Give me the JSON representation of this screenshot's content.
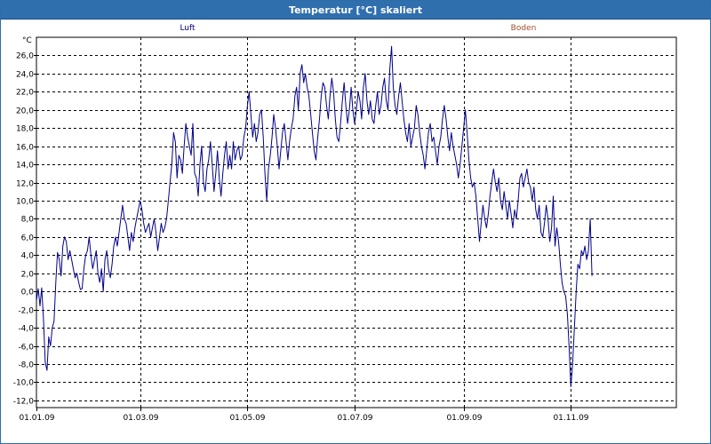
{
  "window": {
    "title": "Temperatur [°C] skaliert"
  },
  "chart_data": {
    "type": "line",
    "title": "Temperatur [°C] skaliert",
    "ylabel": "°C",
    "xlabel": "",
    "ylim": [
      -12.8,
      28.0
    ],
    "grid": true,
    "legend_placement": "top",
    "x_tick_labels": [
      "01.01.09",
      "01.03.09",
      "01.05.09",
      "01.07.09",
      "01.09.09",
      "01.11.09"
    ],
    "x_tick_days": [
      0,
      59,
      120,
      181,
      243,
      304
    ],
    "y_ticks": [
      -12.0,
      -10.0,
      -8.0,
      -6.0,
      -4.0,
      -2.0,
      0.0,
      2.0,
      4.0,
      6.0,
      8.0,
      10.0,
      12.0,
      14.0,
      16.0,
      18.0,
      20.0,
      22.0,
      24.0,
      26.0
    ],
    "y_tick_labels": [
      "-12,0",
      "-10,0",
      "-8,0",
      "-6,0",
      "-4,0",
      "-2,0",
      "0,0",
      "2,0",
      "4,0",
      "6,0",
      "8,0",
      "10,0",
      "12,0",
      "14,0",
      "16,0",
      "18,0",
      "20,0",
      "22,0",
      "24,0",
      "26,0"
    ],
    "x_range_days": [
      0,
      364
    ],
    "series": [
      {
        "name": "Luft",
        "color": "#00008b",
        "points": [
          [
            0,
            -1.0
          ],
          [
            1,
            0.3
          ],
          [
            2,
            -1.6
          ],
          [
            3,
            0.4
          ],
          [
            4,
            -3.0
          ],
          [
            5,
            -7.8
          ],
          [
            6,
            -8.7
          ],
          [
            7,
            -5.0
          ],
          [
            8,
            -6.0
          ],
          [
            9,
            -4.0
          ],
          [
            10,
            -3.3
          ],
          [
            11,
            1.0
          ],
          [
            12,
            4.3
          ],
          [
            13,
            3.5
          ],
          [
            14,
            1.7
          ],
          [
            15,
            5.0
          ],
          [
            16,
            6.0
          ],
          [
            17,
            5.5
          ],
          [
            18,
            3.5
          ],
          [
            19,
            4.5
          ],
          [
            20,
            3.5
          ],
          [
            21,
            2.5
          ],
          [
            22,
            1.5
          ],
          [
            23,
            2.0
          ],
          [
            24,
            1.0
          ],
          [
            25,
            0.2
          ],
          [
            26,
            0.3
          ],
          [
            27,
            2.5
          ],
          [
            28,
            4.0
          ],
          [
            29,
            4.5
          ],
          [
            30,
            6.0
          ],
          [
            31,
            4.0
          ],
          [
            32,
            2.5
          ],
          [
            33,
            3.5
          ],
          [
            34,
            4.5
          ],
          [
            35,
            2.0
          ],
          [
            36,
            1.0
          ],
          [
            37,
            2.5
          ],
          [
            38,
            0.0
          ],
          [
            39,
            3.5
          ],
          [
            40,
            4.5
          ],
          [
            41,
            2.5
          ],
          [
            42,
            1.5
          ],
          [
            43,
            3.0
          ],
          [
            44,
            5.0
          ],
          [
            45,
            6.0
          ],
          [
            46,
            5.0
          ],
          [
            47,
            6.5
          ],
          [
            48,
            8.0
          ],
          [
            49,
            9.5
          ],
          [
            50,
            8.0
          ],
          [
            51,
            7.5
          ],
          [
            52,
            6.0
          ],
          [
            53,
            4.5
          ],
          [
            54,
            6.5
          ],
          [
            55,
            5.5
          ],
          [
            56,
            7.0
          ],
          [
            57,
            8.0
          ],
          [
            58,
            9.0
          ],
          [
            59,
            10.0
          ],
          [
            60,
            9.0
          ],
          [
            61,
            7.5
          ],
          [
            62,
            6.5
          ],
          [
            63,
            7.0
          ],
          [
            64,
            7.5
          ],
          [
            65,
            6.0
          ],
          [
            66,
            7.0
          ],
          [
            67,
            8.0
          ],
          [
            68,
            6.5
          ],
          [
            69,
            4.5
          ],
          [
            70,
            6.0
          ],
          [
            71,
            7.5
          ],
          [
            72,
            6.5
          ],
          [
            73,
            7.0
          ],
          [
            74,
            8.0
          ],
          [
            75,
            10.0
          ],
          [
            76,
            12.0
          ],
          [
            77,
            14.0
          ],
          [
            78,
            17.5
          ],
          [
            79,
            16.5
          ],
          [
            80,
            12.5
          ],
          [
            81,
            15.0
          ],
          [
            82,
            14.5
          ],
          [
            83,
            13.0
          ],
          [
            84,
            16.0
          ],
          [
            85,
            18.5
          ],
          [
            86,
            17.0
          ],
          [
            87,
            16.0
          ],
          [
            88,
            15.0
          ],
          [
            89,
            18.5
          ],
          [
            90,
            13.0
          ],
          [
            91,
            12.5
          ],
          [
            92,
            10.5
          ],
          [
            93,
            14.0
          ],
          [
            94,
            16.0
          ],
          [
            95,
            12.0
          ],
          [
            96,
            11.0
          ],
          [
            97,
            13.5
          ],
          [
            98,
            14.5
          ],
          [
            99,
            16.5
          ],
          [
            100,
            14.0
          ],
          [
            101,
            11.0
          ],
          [
            102,
            13.0
          ],
          [
            103,
            15.5
          ],
          [
            104,
            12.5
          ],
          [
            105,
            10.5
          ],
          [
            106,
            13.0
          ],
          [
            107,
            15.0
          ],
          [
            108,
            16.5
          ],
          [
            109,
            13.5
          ],
          [
            110,
            15.0
          ],
          [
            111,
            13.5
          ],
          [
            112,
            16.5
          ],
          [
            113,
            14.5
          ],
          [
            114,
            15.5
          ],
          [
            115,
            16.0
          ],
          [
            116,
            14.5
          ],
          [
            117,
            15.0
          ],
          [
            118,
            17.0
          ],
          [
            119,
            18.0
          ],
          [
            120,
            20.5
          ],
          [
            121,
            22.0
          ],
          [
            122,
            19.5
          ],
          [
            123,
            17.0
          ],
          [
            124,
            18.5
          ],
          [
            125,
            16.5
          ],
          [
            126,
            17.5
          ],
          [
            127,
            19.5
          ],
          [
            128,
            20.0
          ],
          [
            129,
            17.0
          ],
          [
            130,
            13.0
          ],
          [
            131,
            10.0
          ],
          [
            132,
            13.5
          ],
          [
            133,
            15.0
          ],
          [
            134,
            17.0
          ],
          [
            135,
            19.5
          ],
          [
            136,
            18.0
          ],
          [
            137,
            16.0
          ],
          [
            138,
            13.5
          ],
          [
            139,
            15.5
          ],
          [
            140,
            17.5
          ],
          [
            141,
            18.5
          ],
          [
            142,
            16.5
          ],
          [
            143,
            14.5
          ],
          [
            144,
            16.5
          ],
          [
            145,
            18.0
          ],
          [
            146,
            19.0
          ],
          [
            147,
            21.5
          ],
          [
            148,
            22.5
          ],
          [
            149,
            20.0
          ],
          [
            150,
            24.0
          ],
          [
            151,
            25.0
          ],
          [
            152,
            23.0
          ],
          [
            153,
            24.0
          ],
          [
            154,
            22.5
          ],
          [
            155,
            21.5
          ],
          [
            156,
            19.5
          ],
          [
            157,
            17.5
          ],
          [
            158,
            15.5
          ],
          [
            159,
            14.5
          ],
          [
            160,
            17.0
          ],
          [
            161,
            19.0
          ],
          [
            162,
            21.5
          ],
          [
            163,
            23.0
          ],
          [
            164,
            22.5
          ],
          [
            165,
            20.5
          ],
          [
            166,
            19.0
          ],
          [
            167,
            21.5
          ],
          [
            168,
            23.5
          ],
          [
            169,
            22.0
          ],
          [
            170,
            19.0
          ],
          [
            171,
            17.0
          ],
          [
            172,
            16.5
          ],
          [
            173,
            18.5
          ],
          [
            174,
            21.0
          ],
          [
            175,
            23.0
          ],
          [
            176,
            20.5
          ],
          [
            177,
            18.5
          ],
          [
            178,
            20.0
          ],
          [
            179,
            22.5
          ],
          [
            180,
            20.0
          ],
          [
            181,
            18.5
          ],
          [
            182,
            20.0
          ],
          [
            183,
            22.0
          ],
          [
            184,
            21.0
          ],
          [
            185,
            19.0
          ],
          [
            186,
            22.5
          ],
          [
            187,
            24.0
          ],
          [
            188,
            21.0
          ],
          [
            189,
            19.5
          ],
          [
            190,
            21.0
          ],
          [
            191,
            19.0
          ],
          [
            192,
            18.5
          ],
          [
            193,
            20.5
          ],
          [
            194,
            22.0
          ],
          [
            195,
            19.5
          ],
          [
            196,
            20.5
          ],
          [
            197,
            22.5
          ],
          [
            198,
            23.5
          ],
          [
            199,
            21.0
          ],
          [
            200,
            20.0
          ],
          [
            201,
            24.5
          ],
          [
            202,
            27.0
          ],
          [
            203,
            22.5
          ],
          [
            204,
            20.5
          ],
          [
            205,
            19.5
          ],
          [
            206,
            21.5
          ],
          [
            207,
            23.0
          ],
          [
            208,
            21.0
          ],
          [
            209,
            19.0
          ],
          [
            210,
            17.5
          ],
          [
            211,
            16.5
          ],
          [
            212,
            18.5
          ],
          [
            213,
            16.0
          ],
          [
            214,
            17.0
          ],
          [
            215,
            18.0
          ],
          [
            216,
            20.5
          ],
          [
            217,
            19.5
          ],
          [
            218,
            17.5
          ],
          [
            219,
            16.0
          ],
          [
            220,
            15.0
          ],
          [
            221,
            13.5
          ],
          [
            222,
            15.5
          ],
          [
            223,
            17.5
          ],
          [
            224,
            18.5
          ],
          [
            225,
            16.5
          ],
          [
            226,
            17.0
          ],
          [
            227,
            15.5
          ],
          [
            228,
            14.0
          ],
          [
            229,
            16.0
          ],
          [
            230,
            17.0
          ],
          [
            231,
            19.0
          ],
          [
            232,
            20.5
          ],
          [
            233,
            19.0
          ],
          [
            234,
            17.0
          ],
          [
            235,
            15.5
          ],
          [
            236,
            17.5
          ],
          [
            237,
            16.0
          ],
          [
            238,
            15.0
          ],
          [
            239,
            14.0
          ],
          [
            240,
            12.5
          ],
          [
            241,
            14.0
          ],
          [
            242,
            16.0
          ],
          [
            243,
            18.0
          ],
          [
            244,
            20.0
          ],
          [
            245,
            17.5
          ],
          [
            246,
            14.5
          ],
          [
            247,
            12.5
          ],
          [
            248,
            11.5
          ],
          [
            249,
            12.0
          ],
          [
            250,
            10.5
          ],
          [
            251,
            8.0
          ],
          [
            252,
            5.5
          ],
          [
            253,
            7.5
          ],
          [
            254,
            9.5
          ],
          [
            255,
            8.0
          ],
          [
            256,
            7.0
          ],
          [
            257,
            8.5
          ],
          [
            258,
            10.5
          ],
          [
            259,
            12.0
          ],
          [
            260,
            13.5
          ],
          [
            261,
            12.0
          ],
          [
            262,
            11.0
          ],
          [
            263,
            12.5
          ],
          [
            264,
            10.0
          ],
          [
            265,
            9.0
          ],
          [
            266,
            11.0
          ],
          [
            267,
            9.5
          ],
          [
            268,
            8.0
          ],
          [
            269,
            10.0
          ],
          [
            270,
            8.5
          ],
          [
            271,
            7.0
          ],
          [
            272,
            9.0
          ],
          [
            273,
            8.0
          ],
          [
            274,
            10.0
          ],
          [
            275,
            12.5
          ],
          [
            276,
            13.0
          ],
          [
            277,
            11.5
          ],
          [
            278,
            12.5
          ],
          [
            279,
            13.5
          ],
          [
            280,
            12.0
          ],
          [
            281,
            11.5
          ],
          [
            282,
            10.0
          ],
          [
            283,
            11.5
          ],
          [
            284,
            9.0
          ],
          [
            285,
            8.0
          ],
          [
            286,
            9.5
          ],
          [
            287,
            6.5
          ],
          [
            288,
            6.0
          ],
          [
            289,
            7.5
          ],
          [
            290,
            9.5
          ],
          [
            291,
            8.0
          ],
          [
            292,
            5.5
          ],
          [
            293,
            7.0
          ],
          [
            294,
            10.5
          ],
          [
            295,
            5.0
          ],
          [
            296,
            7.0
          ],
          [
            297,
            5.5
          ],
          [
            298,
            3.0
          ],
          [
            299,
            1.0
          ],
          [
            300,
            0.0
          ],
          [
            301,
            -0.5
          ],
          [
            302,
            -2.5
          ],
          [
            303,
            -6.0
          ],
          [
            304,
            -10.5
          ],
          [
            305,
            -8.0
          ],
          [
            306,
            -4.0
          ],
          [
            307,
            0.0
          ],
          [
            308,
            3.0
          ],
          [
            309,
            2.5
          ],
          [
            310,
            4.5
          ],
          [
            311,
            4.0
          ],
          [
            312,
            5.0
          ],
          [
            313,
            3.5
          ],
          [
            314,
            4.5
          ],
          [
            315,
            8.0
          ],
          [
            316,
            1.7
          ]
        ]
      },
      {
        "name": "Boden",
        "color": "#a0522d",
        "points": []
      }
    ]
  }
}
